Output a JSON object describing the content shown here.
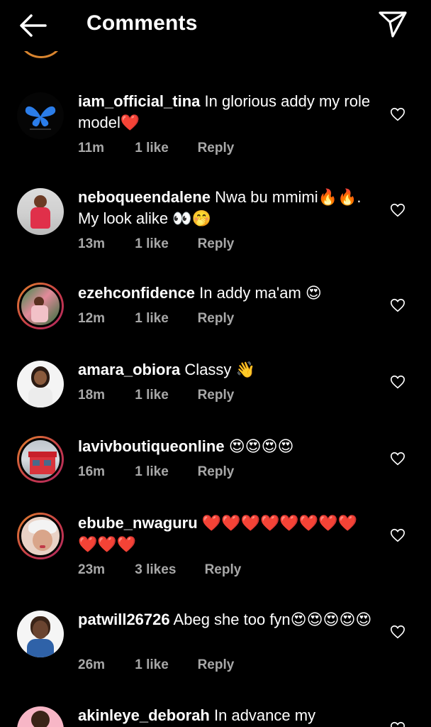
{
  "header": {
    "title": "Comments",
    "back_icon": "arrow-left-icon",
    "send_icon": "paper-plane-icon"
  },
  "colors": {
    "background": "#000000",
    "text": "#ffffff",
    "meta_text": "#a8a8a8",
    "heart_emoji": "#e8202f",
    "story_ring": "#d9852f"
  },
  "comments": [
    {
      "username": "iam_official_tina",
      "text": "In glorious addy my role model❤️",
      "time": "11m",
      "likes": "1 like",
      "reply": "Reply"
    },
    {
      "username": "neboqueendalene",
      "text": "Nwa bu mmimi🔥🔥. My look alike 👀🤭",
      "time": "13m",
      "likes": "1 like",
      "reply": "Reply"
    },
    {
      "username": "ezehconfidence",
      "text": "In addy ma'am 😍",
      "time": "12m",
      "likes": "1 like",
      "reply": "Reply"
    },
    {
      "username": "amara_obiora",
      "text": "Classy 👋",
      "time": "18m",
      "likes": "1 like",
      "reply": "Reply"
    },
    {
      "username": "lavivboutiqueonline",
      "text": "😍😍😍😍",
      "time": "16m",
      "likes": "1 like",
      "reply": "Reply"
    },
    {
      "username": "ebube_nwaguru",
      "text": "❤️❤️❤️❤️❤️❤️❤️❤️❤️❤️❤️",
      "time": "23m",
      "likes": "3 likes",
      "reply": "Reply"
    },
    {
      "username": "patwill26726",
      "text": "Abeg she too fyn😍😍😍😍😍",
      "time": "26m",
      "likes": "1 like",
      "reply": "Reply"
    },
    {
      "username": "akinleye_deborah",
      "text": "In advance my",
      "time": "",
      "likes": "",
      "reply": ""
    }
  ]
}
